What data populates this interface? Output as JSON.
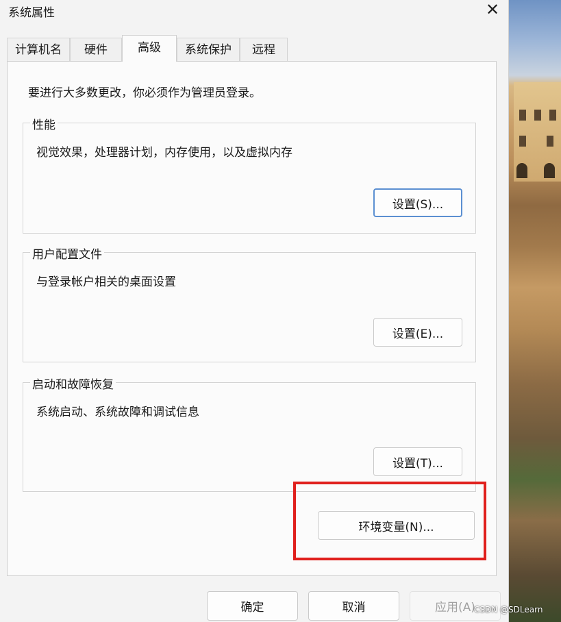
{
  "window": {
    "title": "系统属性",
    "close_glyph": "✕"
  },
  "tabs": [
    {
      "label": "计算机名",
      "active": false
    },
    {
      "label": "硬件",
      "active": false
    },
    {
      "label": "高级",
      "active": true
    },
    {
      "label": "系统保护",
      "active": false
    },
    {
      "label": "远程",
      "active": false
    }
  ],
  "advanced": {
    "notice": "要进行大多数更改，你必须作为管理员登录。",
    "performance": {
      "title": "性能",
      "description": "视觉效果，处理器计划，内存使用，以及虚拟内存",
      "settings_button": "设置(S)..."
    },
    "user_profiles": {
      "title": "用户配置文件",
      "description": "与登录帐户相关的桌面设置",
      "settings_button": "设置(E)..."
    },
    "startup_recovery": {
      "title": "启动和故障恢复",
      "description": "系统启动、系统故障和调试信息",
      "settings_button": "设置(T)..."
    },
    "env_vars_button": "环境变量(N)..."
  },
  "footer": {
    "ok": "确定",
    "cancel": "取消",
    "apply": "应用(A)"
  },
  "annotation": {
    "highlight_color": "#e0201d"
  },
  "watermark": "CSDN @SDLearn"
}
